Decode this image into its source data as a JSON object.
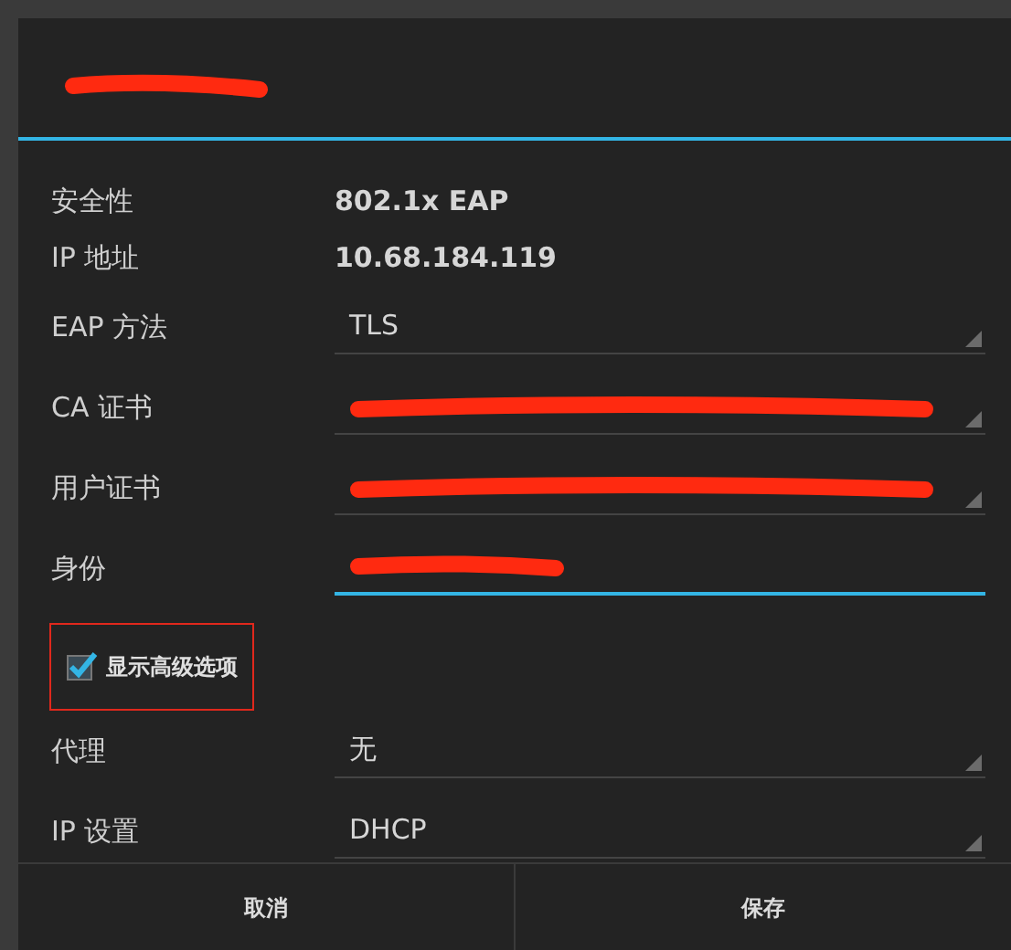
{
  "dialog": {
    "title_redacted": true
  },
  "rows": [
    {
      "kind": "info",
      "label": "安全性",
      "value": "802.1x EAP"
    },
    {
      "kind": "info",
      "label": "IP 地址",
      "value": "10.68.184.119"
    },
    {
      "kind": "select",
      "label": "EAP 方法",
      "value": "TLS"
    },
    {
      "kind": "select",
      "label": "CA 证书",
      "redacted": true
    },
    {
      "kind": "select",
      "label": "用户证书",
      "redacted": true
    },
    {
      "kind": "input",
      "label": "身份",
      "redacted": true,
      "focused": true
    },
    {
      "kind": "checkbox",
      "label": "显示高级选项",
      "checked": true,
      "highlighted": true
    },
    {
      "kind": "select",
      "label": "代理",
      "value": "无"
    },
    {
      "kind": "select",
      "label": "IP 设置",
      "value": "DHCP"
    }
  ],
  "buttons": [
    {
      "label": "取消"
    },
    {
      "label": "保存"
    }
  ]
}
